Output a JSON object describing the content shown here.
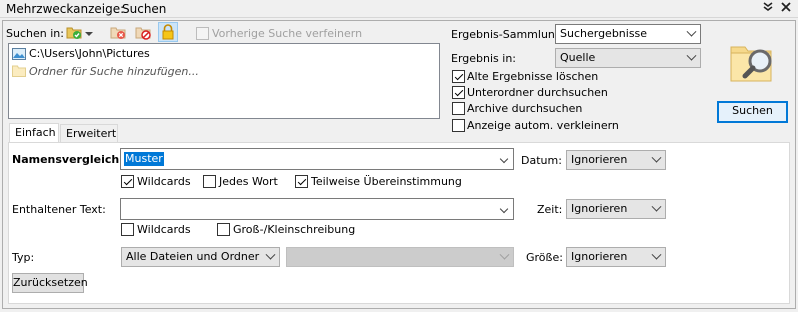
{
  "titlebar": {
    "label": "Mehrzweckanzeige:",
    "value": "Suchen",
    "dropdown_icon": "double-chevron-down-icon",
    "close_icon": "close-icon"
  },
  "search_in": {
    "label": "Suchen in:",
    "toolbar_icons": [
      "add-folder-icon",
      "remove-folder-icon",
      "clear-list-icon",
      "lock-icon"
    ],
    "refine_label": "Vorherige Suche verfeinern",
    "folders": [
      {
        "icon": "pictures-folder-icon",
        "text": "C:\\Users\\John\\Pictures"
      },
      {
        "icon": "folder-icon",
        "text": "Ordner für Suche hinzufügen..."
      }
    ]
  },
  "options": {
    "result_collection_label": "Ergebnis-Sammlung:",
    "result_collection_value": "Suchergebnisse",
    "result_in_label": "Ergebnis in:",
    "result_in_value": "Quelle",
    "checkboxes": [
      {
        "label": "Alte Ergebnisse löschen",
        "checked": true
      },
      {
        "label": "Unterordner durchsuchen",
        "checked": true
      },
      {
        "label": "Archive durchsuchen",
        "checked": false
      },
      {
        "label": "Anzeige autom. verkleinern",
        "checked": false
      }
    ],
    "search_button": "Suchen",
    "search_icon": "folder-magnifier-icon"
  },
  "tabs": [
    {
      "label": "Einfach",
      "active": true
    },
    {
      "label": "Erweitert",
      "active": false
    }
  ],
  "simple": {
    "name_label": "Namensvergleich:",
    "name_value": "Muster",
    "name_checks": [
      {
        "label": "Wildcards",
        "checked": true
      },
      {
        "label": "Jedes Wort",
        "checked": false
      },
      {
        "label": "Teilweise Übereinstimmung",
        "checked": true
      }
    ],
    "date_label": "Datum:",
    "date_value": "Ignorieren",
    "content_label": "Enthaltener Text:",
    "content_value": "",
    "content_checks": [
      {
        "label": "Wildcards",
        "checked": false
      },
      {
        "label": "Groß-/Kleinschreibung",
        "checked": false
      }
    ],
    "time_label": "Zeit:",
    "time_value": "Ignorieren",
    "type_label": "Typ:",
    "type_value": "Alle Dateien und Ordner",
    "type_sub_value": "",
    "size_label": "Größe:",
    "size_value": "Ignorieren",
    "reset_button": "Zurücksetzen"
  }
}
